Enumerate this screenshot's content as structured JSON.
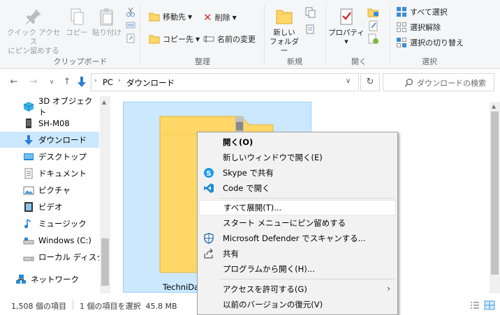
{
  "ribbon": {
    "clipboard": {
      "quick_access": "クイック アクセス\nにピン留めする",
      "copy": "コピー",
      "paste": "貼り付け",
      "group": "クリップボード"
    },
    "organize": {
      "move_to": "移動先",
      "copy_to": "コピー先",
      "delete": "削除",
      "rename": "名前の変更",
      "group": "整理"
    },
    "new": {
      "new_folder": "新しい\nフォルダー",
      "group": "新規"
    },
    "open": {
      "properties": "プロパティ",
      "group": "開く"
    },
    "select": {
      "select_all": "すべて選択",
      "select_none": "選択解除",
      "invert": "選択の切り替え",
      "group": "選択"
    }
  },
  "address": {
    "root": "PC",
    "current": "ダウンロード",
    "search_placeholder": "ダウンロードの検索"
  },
  "nav": {
    "items": [
      {
        "label": "3D オブジェクト",
        "icon": "cube-icon"
      },
      {
        "label": "SH-M08",
        "icon": "phone-icon"
      },
      {
        "label": "ダウンロード",
        "icon": "download-icon",
        "selected": true
      },
      {
        "label": "デスクトップ",
        "icon": "desktop-icon"
      },
      {
        "label": "ドキュメント",
        "icon": "document-icon"
      },
      {
        "label": "ピクチャ",
        "icon": "pictures-icon"
      },
      {
        "label": "ビデオ",
        "icon": "video-icon"
      },
      {
        "label": "ミュージック",
        "icon": "music-icon"
      },
      {
        "label": "Windows (C:)",
        "icon": "drive-icon"
      },
      {
        "label": "ローカル ディスク (E",
        "icon": "drive-icon"
      }
    ],
    "network": "ネットワーク"
  },
  "file": {
    "name": "TechniDa"
  },
  "context_menu": {
    "items": [
      {
        "label": "開く(O)",
        "bold": true
      },
      {
        "label": "新しいウィンドウで開く(E)"
      },
      {
        "label": "Skype で共有",
        "icon": "skype-icon"
      },
      {
        "label": "Code で開く",
        "icon": "vscode-icon"
      },
      {
        "label": "すべて展開(T)...",
        "highlighted": true
      },
      {
        "label": "スタート メニューにピン留めする"
      },
      {
        "label": "Microsoft Defender でスキャンする...",
        "icon": "defender-icon"
      },
      {
        "label": "共有",
        "icon": "share-icon"
      },
      {
        "label": "プログラムから開く(H)..."
      },
      {
        "label": "アクセスを許可する(G)",
        "submenu": true
      },
      {
        "label": "以前のバージョンの復元(V)"
      }
    ]
  },
  "status": {
    "item_count": "1,508 個の項目",
    "selected": "1 個の項目を選択  45.8 MB"
  },
  "colors": {
    "selection": "#cce8ff",
    "accent": "#0078d7",
    "folder": "#ffd766"
  }
}
